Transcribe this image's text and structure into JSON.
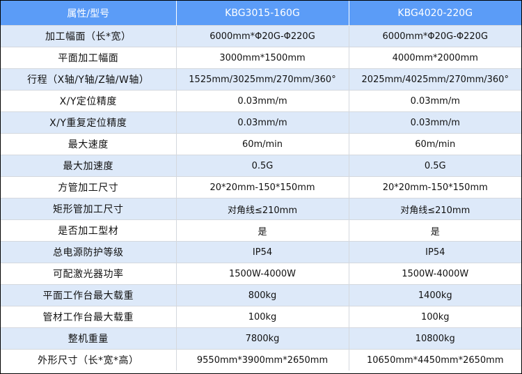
{
  "table": {
    "headers": [
      "属性/型号",
      "KBG3015-160G",
      "KBG4020-220G"
    ],
    "rows": [
      [
        "加工幅面（长*宽）",
        "6000mm*Φ20G-Φ220G",
        "6000mm*Φ20G-Φ220G"
      ],
      [
        "平面加工幅面",
        "3000mm*1500mm",
        "4000mm*2000mm"
      ],
      [
        "行程（X轴/Y轴/Z轴/W轴）",
        "1525mm/3025mm/270mm/360°",
        "2025mm/4025mm/270mm/360°"
      ],
      [
        "X/Y定位精度",
        "0.03mm/m",
        "0.03mm/m"
      ],
      [
        "X/Y重复定位精度",
        "0.03mm/m",
        "0.03mm/m"
      ],
      [
        "最大速度",
        "60m/min",
        "60m/min"
      ],
      [
        "最大加速度",
        "0.5G",
        "0.5G"
      ],
      [
        "方管加工尺寸",
        "20*20mm-150*150mm",
        "20*20mm-150*150mm"
      ],
      [
        "矩形管加工尺寸",
        "对角线≤210mm",
        "对角线≤210mm"
      ],
      [
        "是否加工型材",
        "是",
        "是"
      ],
      [
        "总电源防护等级",
        "IP54",
        "IP54"
      ],
      [
        "可配激光器功率",
        "1500W-4000W",
        "1500W-4000W"
      ],
      [
        "平面工作台最大载重",
        "800kg",
        "1400kg"
      ],
      [
        "管材工作台最大载重",
        "100kg",
        "100kg"
      ],
      [
        "整机重量",
        "7800kg",
        "10800kg"
      ],
      [
        "外形尺寸（长*宽*高）",
        "9550mm*3900mm*2650mm",
        "10650mm*4450mm*2650mm"
      ]
    ]
  },
  "colors": {
    "header_bg": "#5b9cf7",
    "header_text": "#ffffff",
    "row_stripe": "#dde9f9",
    "border": "#d4d8de"
  }
}
